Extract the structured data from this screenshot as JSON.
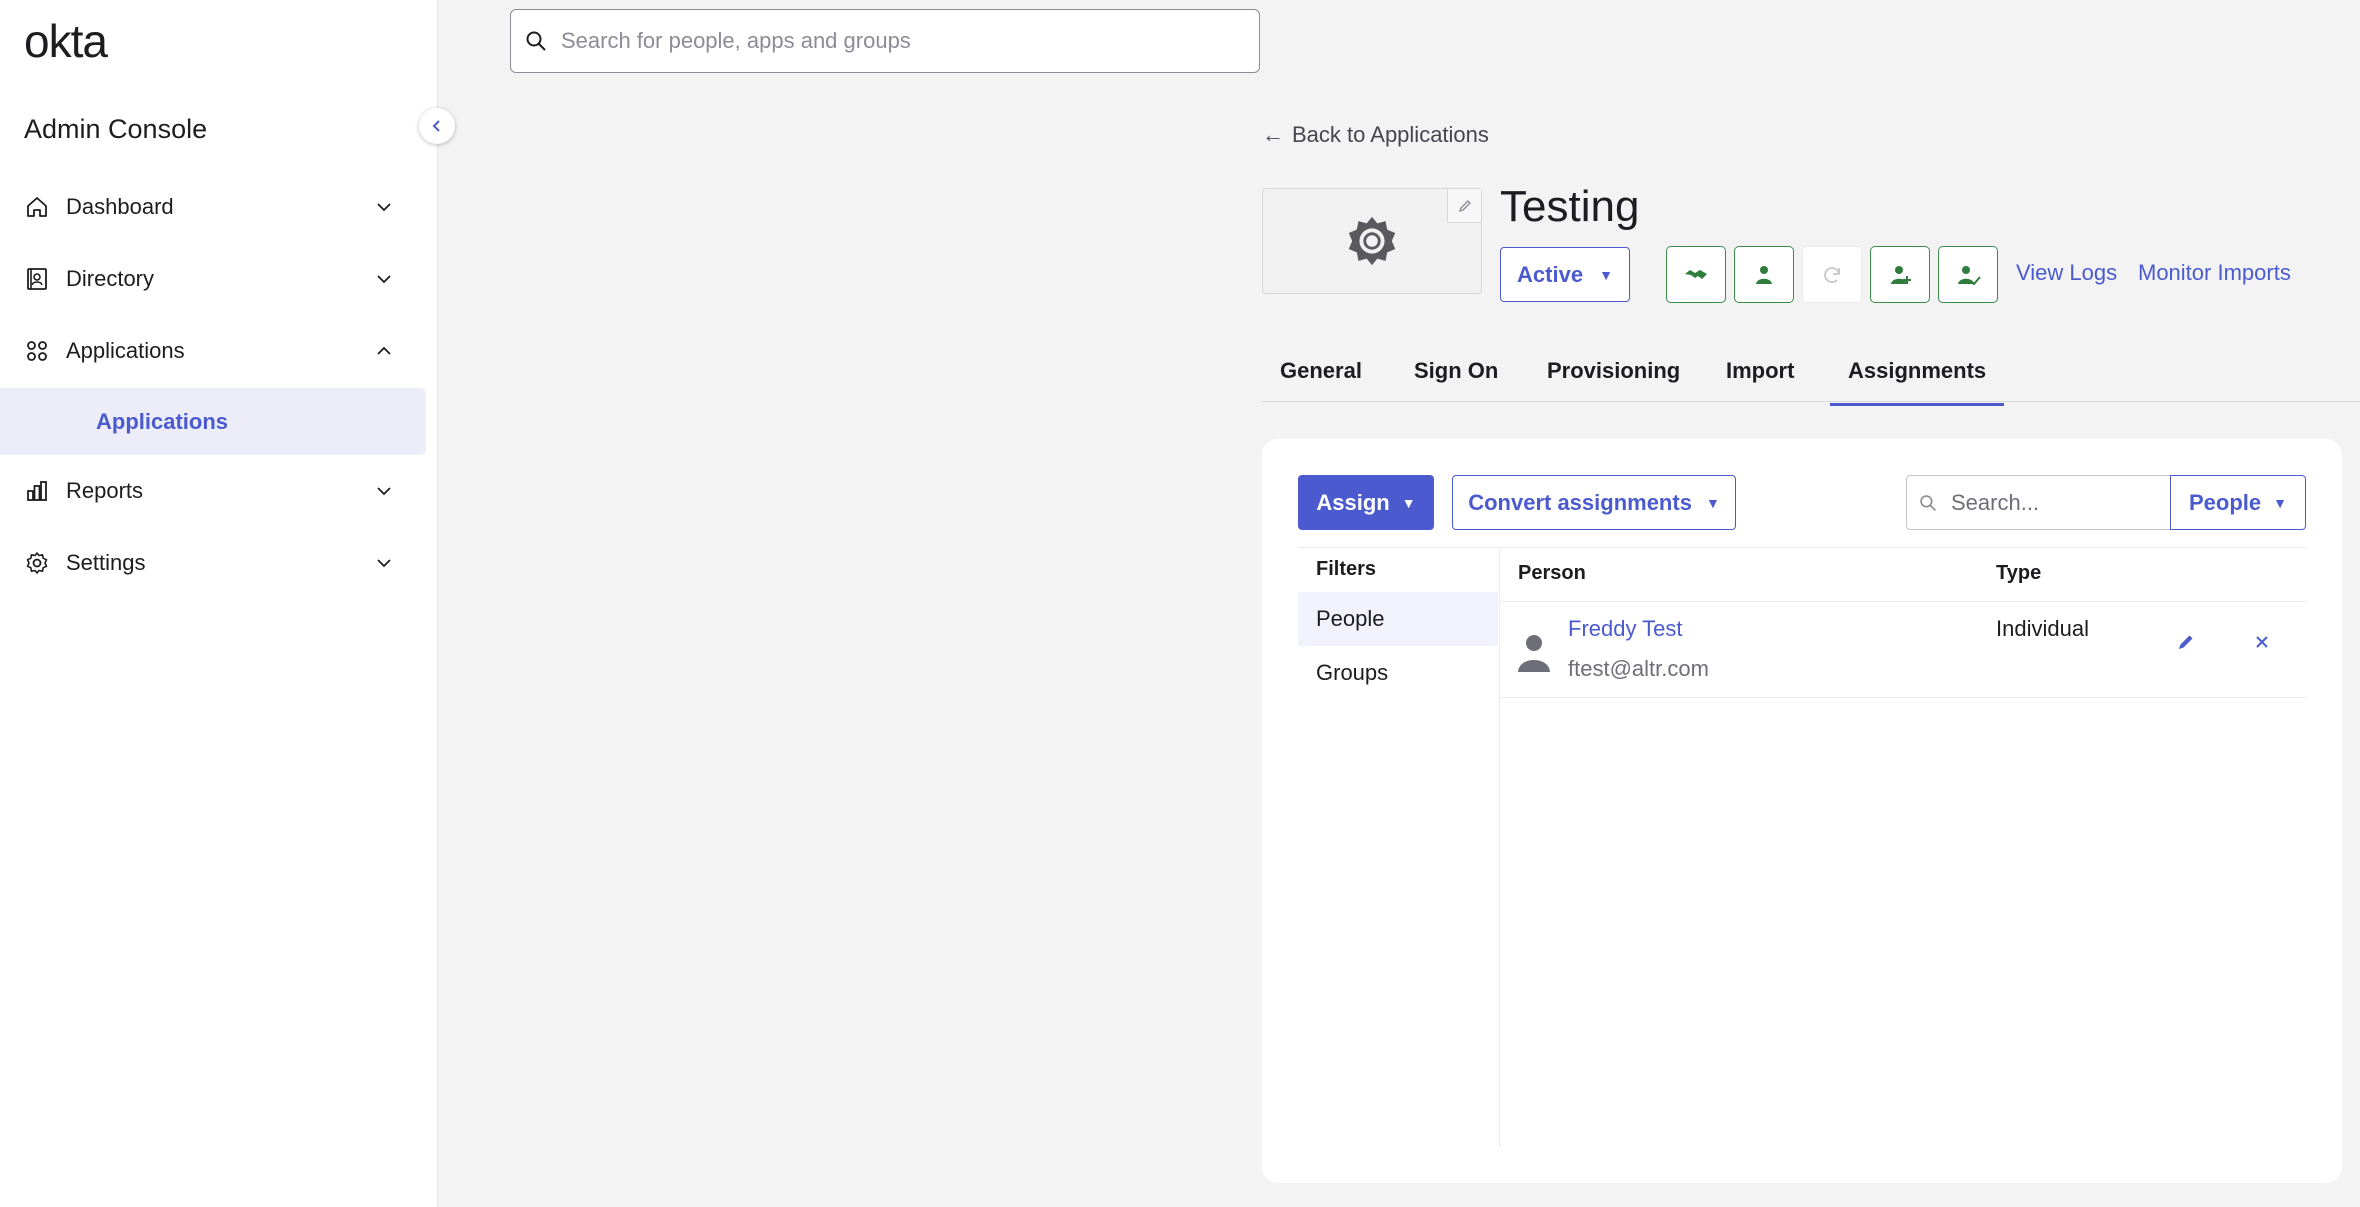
{
  "brand": {
    "logo_text": "okta",
    "console_title": "Admin Console",
    "accent": "#4b5bcf",
    "green": "#3a8a4a"
  },
  "global_search": {
    "placeholder": "Search for people, apps and groups"
  },
  "sidebar": {
    "items": [
      {
        "label": "Dashboard",
        "icon": "home-icon",
        "expanded": false
      },
      {
        "label": "Directory",
        "icon": "directory-icon",
        "expanded": false
      },
      {
        "label": "Applications",
        "icon": "apps-grid-icon",
        "expanded": true
      },
      {
        "label": "Reports",
        "icon": "reports-icon",
        "expanded": false
      },
      {
        "label": "Settings",
        "icon": "gear-icon",
        "expanded": false
      }
    ],
    "active_subitem": "Applications"
  },
  "header": {
    "back_link": "Back to Applications",
    "app_title": "Testing",
    "status": "Active",
    "links": {
      "view_logs": "View Logs",
      "monitor_imports": "Monitor Imports"
    }
  },
  "tabs": [
    "General",
    "Sign On",
    "Provisioning",
    "Import",
    "Assignments"
  ],
  "active_tab": "Assignments",
  "assignments": {
    "assign_label": "Assign",
    "convert_label": "Convert assignments",
    "search_placeholder": "Search...",
    "scope_select": "People",
    "filters_title": "Filters",
    "filters": [
      "People",
      "Groups"
    ],
    "active_filter": "People",
    "columns": {
      "person": "Person",
      "type": "Type"
    },
    "rows": [
      {
        "name": "Freddy Test",
        "email": "ftest@altr.com",
        "type": "Individual"
      }
    ]
  }
}
